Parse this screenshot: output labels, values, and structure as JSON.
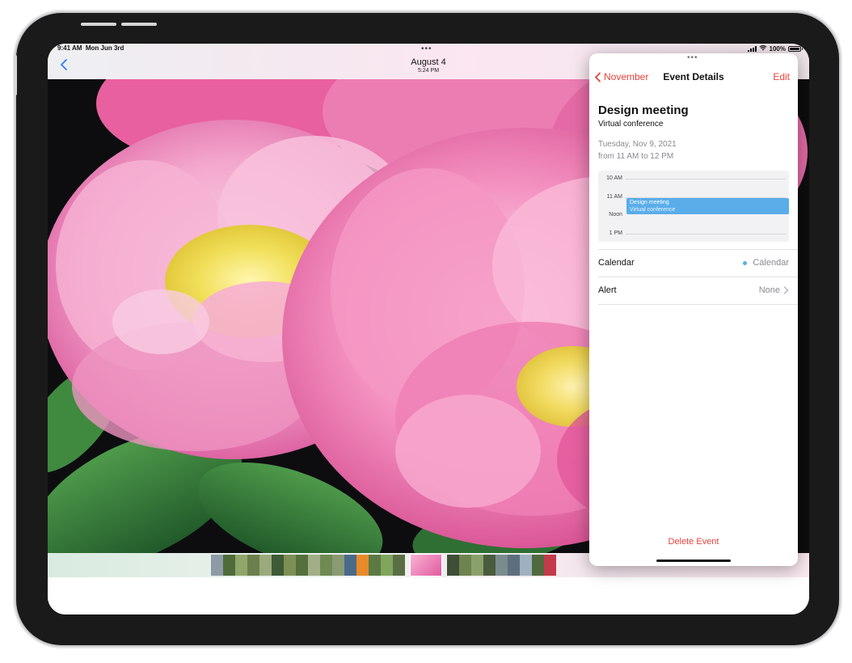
{
  "status_bar": {
    "time": "9:41 AM",
    "date": "Mon Jun 3rd",
    "battery": "100%"
  },
  "photos": {
    "title": "August 4",
    "subtitle": "5:24 PM"
  },
  "event_details": {
    "nav_back": "November",
    "nav_title": "Event Details",
    "nav_edit": "Edit",
    "title": "Design meeting",
    "location": "Virtual conference",
    "date": "Tuesday, Nov 9, 2021",
    "time_range": "from 11 AM to 12 PM",
    "timeline": {
      "labels": [
        "10 AM",
        "11 AM",
        "Noon",
        "1 PM"
      ],
      "event_title": "Design meeting",
      "event_subtitle": "Virtual conference"
    },
    "calendar_label": "Calendar",
    "calendar_value": "Calendar",
    "alert_label": "Alert",
    "alert_value": "None",
    "delete_label": "Delete Event"
  },
  "colors": {
    "accent_red": "#e8423a",
    "event_blue": "#5aade9",
    "ios_blue": "#2f7cf6"
  }
}
